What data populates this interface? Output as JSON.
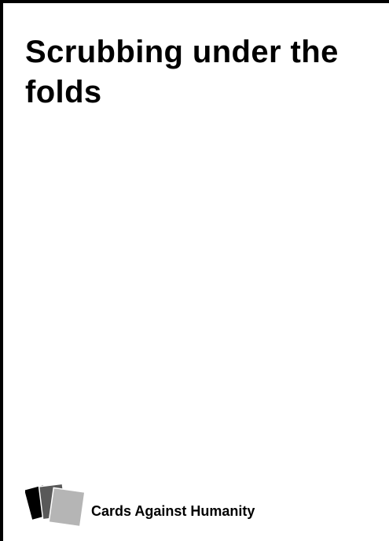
{
  "card": {
    "text": "Scrubbing under the folds",
    "brand": "Cards Against Humanity"
  },
  "logo": {
    "icon": "stacked-cards-icon",
    "colors": [
      "#000000",
      "#595959",
      "#b5b5b5"
    ]
  }
}
